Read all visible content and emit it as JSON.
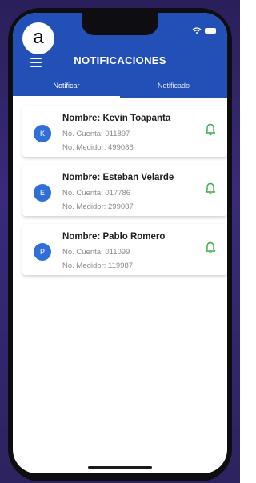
{
  "label_a": "a",
  "app": {
    "title": "NOTIFICACIONES"
  },
  "tabs": [
    {
      "label": "Notificar",
      "active": true
    },
    {
      "label": "Notificado",
      "active": false
    }
  ],
  "items": [
    {
      "initial": "K",
      "name": "Nombre: Kevin Toapanta",
      "cuenta": "No. Cuenta: 011897",
      "medidor": "No. Medidor: 499088"
    },
    {
      "initial": "E",
      "name": "Nombre: Esteban Velarde",
      "cuenta": "No. Cuenta: 017786",
      "medidor": "No. Medidor: 299087"
    },
    {
      "initial": "P",
      "name": "Nombre: Pablo Romero",
      "cuenta": "No. Cuenta: 011099",
      "medidor": "No. Medidor: 119987"
    }
  ],
  "icons": {
    "menu": "menu-icon",
    "bell": "bell-icon",
    "wifi": "wifi-icon",
    "battery": "battery-icon"
  },
  "colors": {
    "header": "#2350b6",
    "avatar": "#2f6fd6",
    "bell": "#3aa64a"
  }
}
